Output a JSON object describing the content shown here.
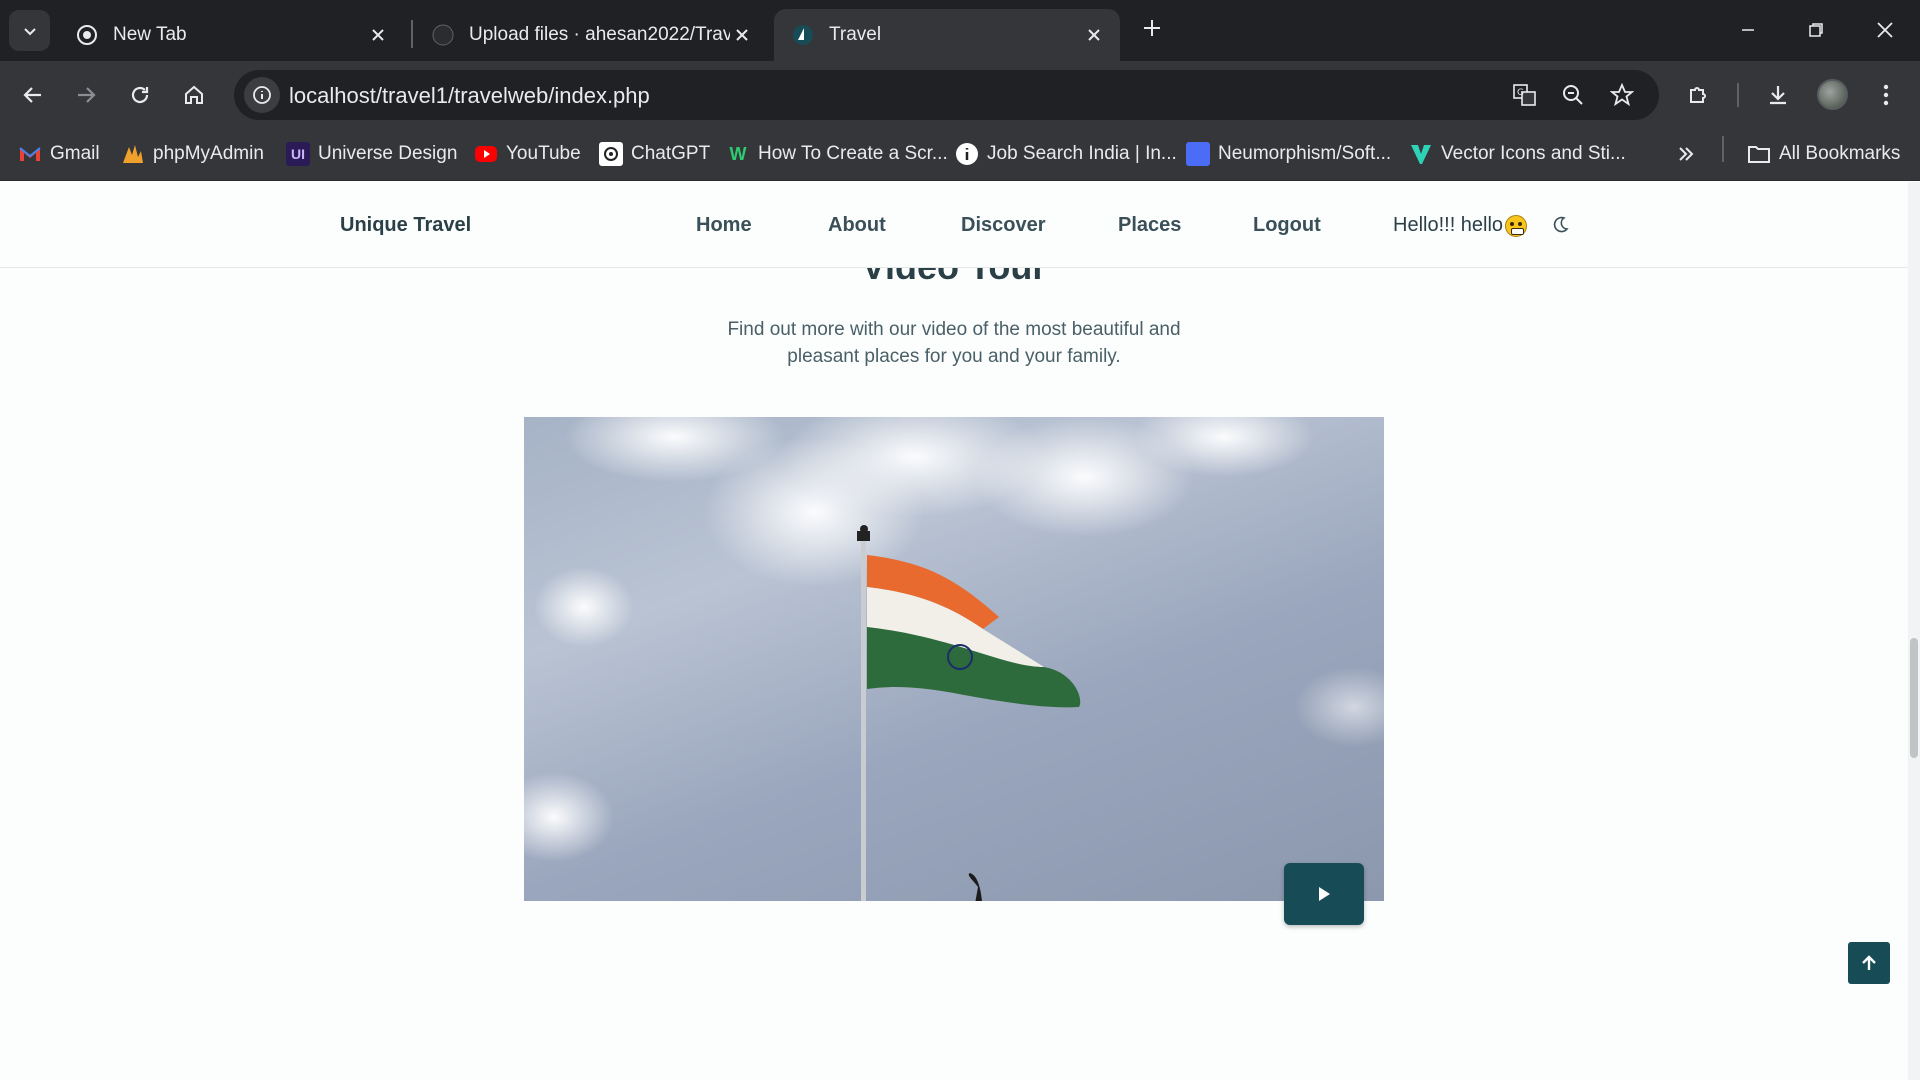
{
  "browser": {
    "tabs": [
      {
        "title": "New Tab",
        "active": false
      },
      {
        "title": "Upload files · ahesan2022/Trave",
        "active": false
      },
      {
        "title": "Travel",
        "active": true
      }
    ],
    "url": "localhost/travel1/travelweb/index.php",
    "bookmarks": [
      {
        "label": "Gmail"
      },
      {
        "label": "phpMyAdmin"
      },
      {
        "label": "Universe Design"
      },
      {
        "label": "YouTube"
      },
      {
        "label": "ChatGPT"
      },
      {
        "label": "How To Create a Scr..."
      },
      {
        "label": "Job Search India | In..."
      },
      {
        "label": "Neumorphism/Soft..."
      },
      {
        "label": "Vector Icons and Sti..."
      }
    ],
    "all_bookmarks": "All Bookmarks"
  },
  "site": {
    "brand": "Unique Travel",
    "nav": [
      {
        "label": "Home"
      },
      {
        "label": "About"
      },
      {
        "label": "Discover"
      },
      {
        "label": "Places"
      },
      {
        "label": "Logout"
      }
    ],
    "greeting": "Hello!!! hello",
    "section_heading": "Video Tour",
    "subtitle": "Find out more with our video of the most beautiful and pleasant places for you and your family."
  },
  "colors": {
    "accent": "#174c57",
    "text_dark": "#2b3f47",
    "background": "#fbfefd"
  },
  "icons": {
    "play": "play-icon",
    "scroll_up": "arrow-up-icon",
    "theme": "moon-icon"
  }
}
